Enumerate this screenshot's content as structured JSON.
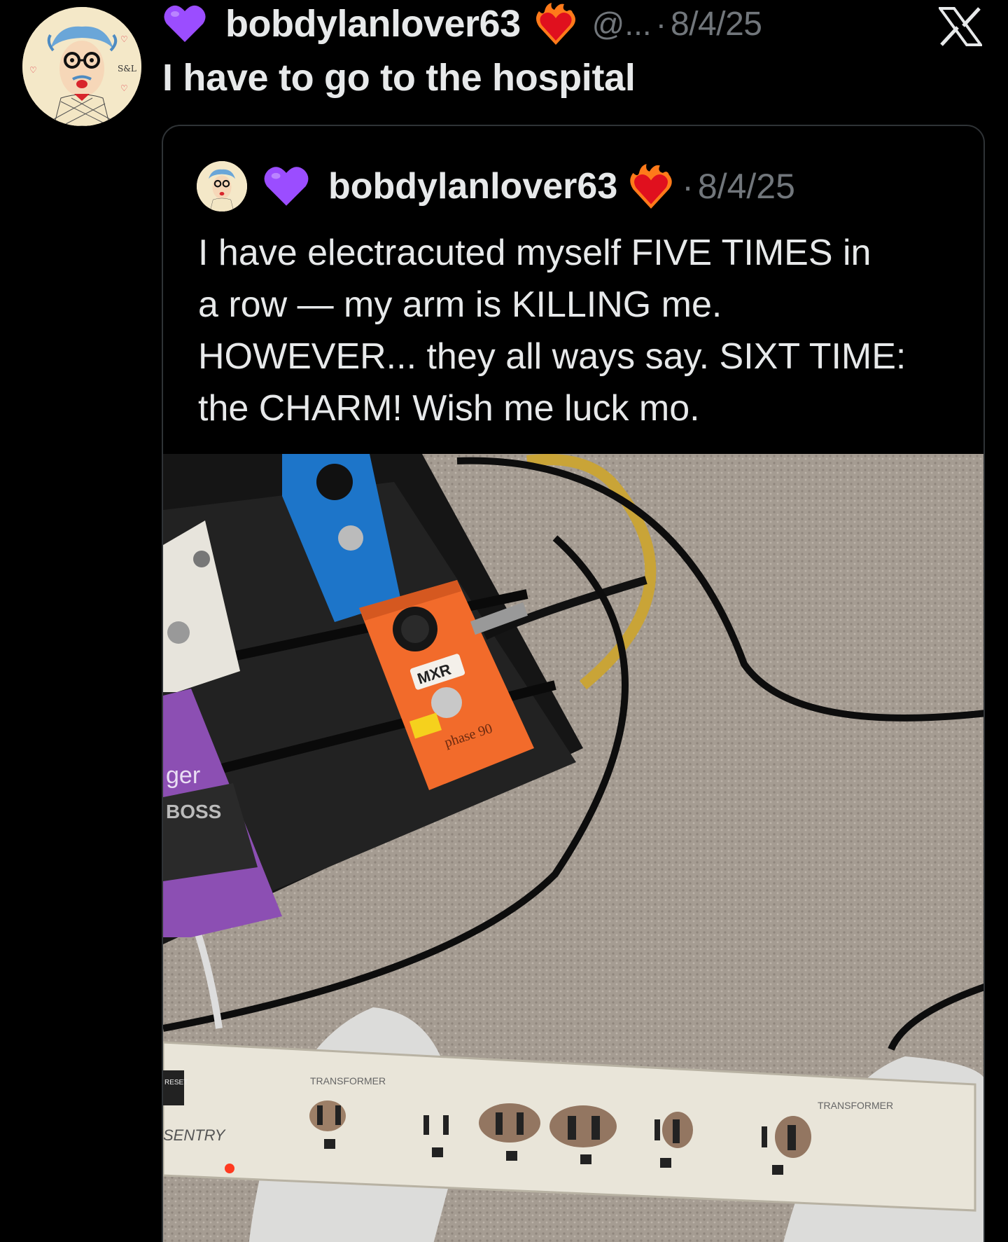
{
  "post": {
    "author": {
      "username": "bobdylanlover63",
      "handle": "@...",
      "badge_left": "purple-heart-icon",
      "badge_right": "heart-on-fire-icon"
    },
    "separator": "·",
    "date": "8/4/25",
    "text": "I have to go to the hospital",
    "platform_icon": "x-logo-icon"
  },
  "quoted": {
    "author": {
      "username": "bobdylanlover63",
      "badge_left": "purple-heart-icon",
      "badge_right": "heart-on-fire-icon"
    },
    "separator": "·",
    "date": "8/4/25",
    "text_lines": [
      "I have electracuted myself FIVE TIMES in",
      "a row — my arm is KILLING me.",
      "HOWEVER... they all ways say. SIXT TIME:",
      "the CHARM! Wish me luck mo."
    ],
    "image": {
      "pedal_labels": [
        "MXR",
        "phase 90",
        "ger",
        "BOSS"
      ],
      "strip_labels": [
        "TRANSFORMER",
        "TRANSFORMER",
        "SENTRY",
        "RESET"
      ]
    }
  },
  "colors": {
    "background": "#000000",
    "text_primary": "#e7e9ea",
    "text_secondary": "#71767b",
    "border": "#2f3336",
    "purple_heart": "#9b4dff",
    "orange_pedal": "#f36b2c",
    "blue_pedal": "#1a73c7",
    "purple_pedal": "#8c4fb3"
  }
}
